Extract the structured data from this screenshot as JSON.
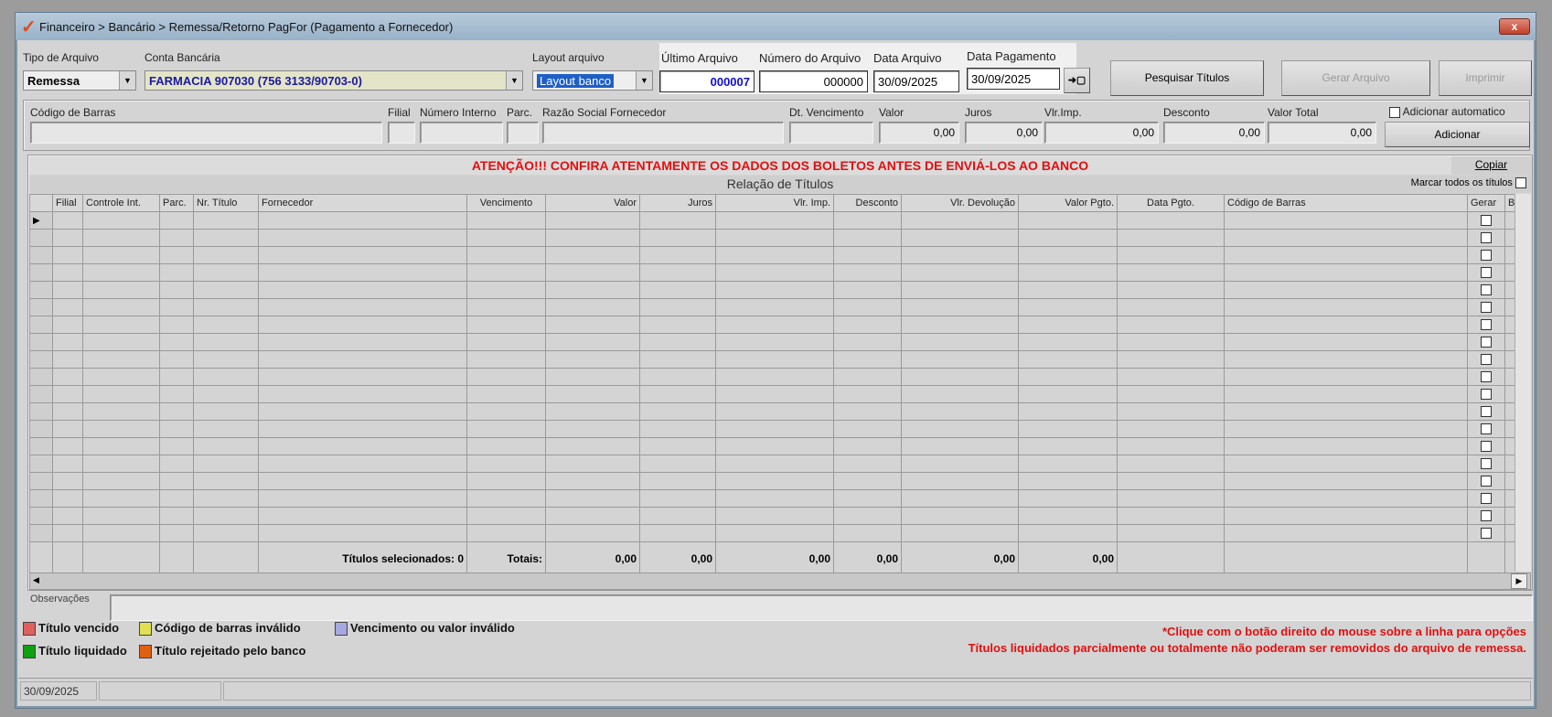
{
  "window": {
    "title": "Financeiro > Bancário > Remessa/Retorno PagFor (Pagamento  a Fornecedor)",
    "close": "x"
  },
  "top": {
    "tipo_label": "Tipo de Arquivo",
    "tipo_value": "Remessa",
    "conta_label": "Conta Bancária",
    "conta_value": "FARMACIA 907030 (756 3133/90703-0)",
    "layout_label": "Layout arquivo",
    "layout_value": "Layout banco",
    "ultimo_label": "Último Arquivo",
    "ultimo_value": "000007",
    "numero_label": "Número do Arquivo",
    "numero_value": "000000",
    "data_arq_label": "Data Arquivo",
    "data_arq_value": "30/09/2025",
    "data_pag_label": "Data Pagamento",
    "data_pag_value": "30/09/2025",
    "arrow_btn": "➜▢",
    "pesquisar": "Pesquisar Títulos",
    "gerar": "Gerar Arquivo",
    "imprimir": "Imprimir"
  },
  "entry": {
    "codigo": "Código de Barras",
    "filial": "Filial",
    "num_int": "Número Interno",
    "parc": "Parc.",
    "razao": "Razão Social Fornecedor",
    "dt_venc": "Dt. Vencimento",
    "valor": "Valor",
    "valor_v": "0,00",
    "juros": "Juros",
    "juros_v": "0,00",
    "vlr_imp": "Vlr.Imp.",
    "vlr_imp_v": "0,00",
    "desconto": "Desconto",
    "desconto_v": "0,00",
    "valor_total": "Valor Total",
    "valor_total_v": "0,00",
    "auto": "Adicionar automatico",
    "adicionar": "Adicionar"
  },
  "grid": {
    "attention": "ATENÇÃO!!! CONFIRA ATENTAMENTE OS DADOS DOS BOLETOS ANTES DE ENVIÁ-LOS AO BANCO",
    "copiar": "Copiar",
    "title": "Relação de Títulos",
    "marcar": "Marcar todos os títulos",
    "columns": [
      "",
      "Filial",
      "Controle Int.",
      "Parc.",
      "Nr. Título",
      "Fornecedor",
      "Vencimento",
      "Valor",
      "Juros",
      "Vlr. Imp.",
      "Desconto",
      "Vlr. Devolução",
      "Valor Pgto.",
      "Data Pgto.",
      "Código de Barras",
      "Gerar",
      "B"
    ],
    "totals": {
      "selecionados": "Títulos selecionados: 0",
      "totais": "Totais:",
      "valor": "0,00",
      "juros": "0,00",
      "vlr_imp": "0,00",
      "desconto": "0,00",
      "vlr_dev": "0,00",
      "valor_pgto": "0,00"
    }
  },
  "obs_label": "Observações",
  "legend": [
    {
      "label": "Título vencido",
      "color": "#e06060"
    },
    {
      "label": "Código de barras inválido",
      "color": "#e0e050"
    },
    {
      "label": "Vencimento ou valor inválido",
      "color": "#a8a8e0"
    },
    {
      "label": "Título liquidado",
      "color": "#10a010"
    },
    {
      "label": "Título rejeitado pelo banco",
      "color": "#e06010"
    }
  ],
  "notes": [
    "*Clique com o botão direito do mouse sobre a linha para opções",
    "Títulos liquidados parcialmente ou totalmente não poderam ser removidos do arquivo de remessa."
  ],
  "status": {
    "date": "30/09/2025"
  }
}
